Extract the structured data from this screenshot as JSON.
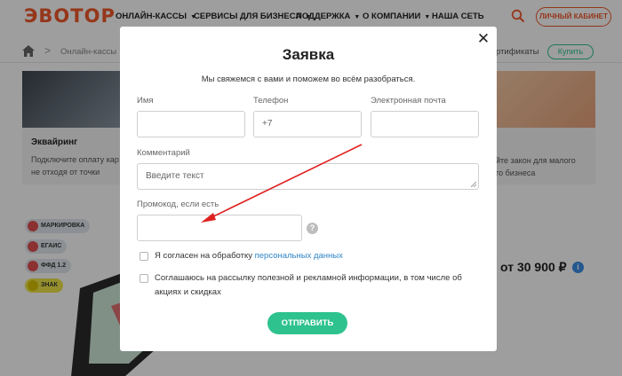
{
  "header": {
    "logo": "ЭВОТОР",
    "nav": [
      "ОНЛАЙН-КАССЫ",
      "СЕРВИСЫ ДЛЯ БИЗНЕСА",
      "ПОДДЕРЖКА",
      "О КОМПАНИИ",
      "НАША СЕТЬ"
    ],
    "cabinet_label": "ЛИЧНЫЙ КАБИНЕТ",
    "search_icon": "search-icon"
  },
  "breadcrumb": {
    "current": "Онлайн-кассы",
    "right_text": "ртификаты",
    "buy_label": "Купить"
  },
  "cards": {
    "left_title": "Эквайринг",
    "left_text_1": "Подключите оплату кар",
    "left_text_2": "не отходя от точки",
    "right_text_1": "йте закон для малого",
    "right_text_2": "го бизнеса"
  },
  "badges": [
    "МАРКИРОВКА",
    "ЕГАИС",
    "ФФД 1.2",
    "ЗНАК"
  ],
  "price": "от 30 900 ₽",
  "modal": {
    "title": "Заявка",
    "subtitle": "Мы свяжемся с вами и поможем во всём разобраться.",
    "name_label": "Имя",
    "phone_label": "Телефон",
    "phone_value": "+7",
    "email_label": "Электронная почта",
    "comment_label": "Комментарий",
    "comment_placeholder": "Введите текст",
    "promo_label": "Промокод, если есть",
    "help_glyph": "?",
    "consent_text": "Я согласен на обработку ",
    "consent_link": "персональных данных",
    "newsletter_line1": "Соглашаюсь на рассылку полезной и рекламной информации, в том числе об",
    "newsletter_line2": "акциях и скидках",
    "submit_label": "ОТПРАВИТЬ",
    "close_glyph": "✕"
  },
  "colors": {
    "brand": "#f0582a",
    "accent_green": "#2ec28f",
    "link": "#2f86c9",
    "arrow": "#e02020"
  }
}
